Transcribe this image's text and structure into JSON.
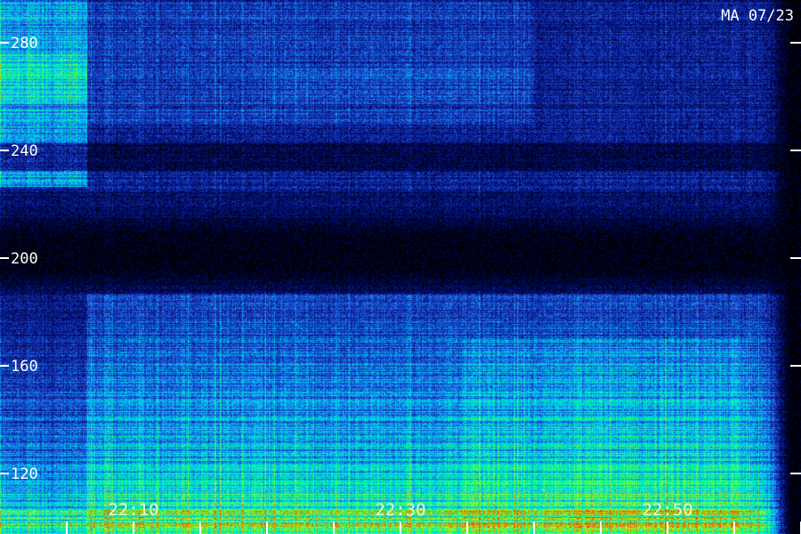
{
  "title": "MA 07/23",
  "chart_data": {
    "type": "heatmap",
    "title": "MA 07/23",
    "y_ticks": [
      {
        "value": 280,
        "label": "280"
      },
      {
        "value": 240,
        "label": "240"
      },
      {
        "value": 200,
        "label": "200"
      },
      {
        "value": 160,
        "label": "160"
      },
      {
        "value": 120,
        "label": "120"
      }
    ],
    "x_ticks": [
      {
        "value": "22:10",
        "label": "22:10"
      },
      {
        "value": "22:30",
        "label": "22:30"
      },
      {
        "value": "22:50",
        "label": "22:50"
      }
    ],
    "x_minor_tick_count": 12,
    "ylim": [
      112,
      295
    ],
    "colormap": [
      "#000000",
      "#000a6e",
      "#1e46d2",
      "#00c8ff",
      "#00ff8c",
      "#c8ff00",
      "#ff3c00"
    ]
  }
}
